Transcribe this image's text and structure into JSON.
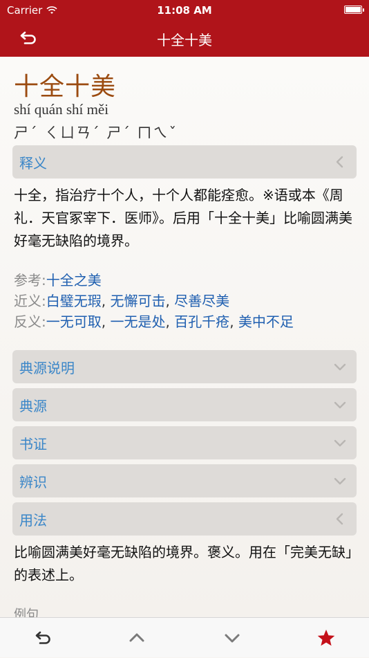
{
  "status": {
    "carrier": "Carrier",
    "time": "11:08 AM"
  },
  "nav": {
    "title": "十全十美",
    "back_icon": "return-arrow-icon"
  },
  "entry": {
    "idiom": "十全十美",
    "pinyin": "shí quán shí měi",
    "zhuyin": "ㄕˊ ㄑㄩㄢˊ ㄕˊ ㄇㄟˇ"
  },
  "sections": {
    "definition": {
      "label": "释义",
      "state": "expanded"
    },
    "source_note": {
      "label": "典源说明",
      "state": "collapsed"
    },
    "source": {
      "label": "典源",
      "state": "collapsed"
    },
    "evidence": {
      "label": "书证",
      "state": "collapsed"
    },
    "discern": {
      "label": "辨识",
      "state": "collapsed"
    },
    "usage": {
      "label": "用法",
      "state": "expanded"
    }
  },
  "definition_text": "十全，指治疗十个人，十个人都能痊愈。※语或本《周礼．天官冢宰下．医师》。后用「十全十美」比喻圆满美好毫无缺陷的境界。",
  "related": {
    "reference_label": "参考:",
    "reference": [
      "十全之美"
    ],
    "synonym_label": "近义:",
    "synonyms": [
      "白璧无瑕",
      "无懈可击",
      "尽善尽美"
    ],
    "antonym_label": "反义:",
    "antonyms": [
      "一无可取",
      "一无是处",
      "百孔千疮",
      "美中不足"
    ],
    "separator": ", "
  },
  "usage_text": "比喻圆满美好毫无缺陷的境界。褒义。用在「完美无缺」的表述上。",
  "examples_label": "例句",
  "tabbar": {
    "items": [
      {
        "icon": "return-arrow-icon"
      },
      {
        "icon": "chevron-up-icon"
      },
      {
        "icon": "chevron-down-icon"
      },
      {
        "icon": "star-icon"
      }
    ],
    "accent": "#b0141a"
  },
  "colors": {
    "header_red": "#b0141a",
    "idiom_brown": "#9b4b10",
    "link_blue": "#1f5fb0",
    "section_label": "#3a86c8"
  }
}
